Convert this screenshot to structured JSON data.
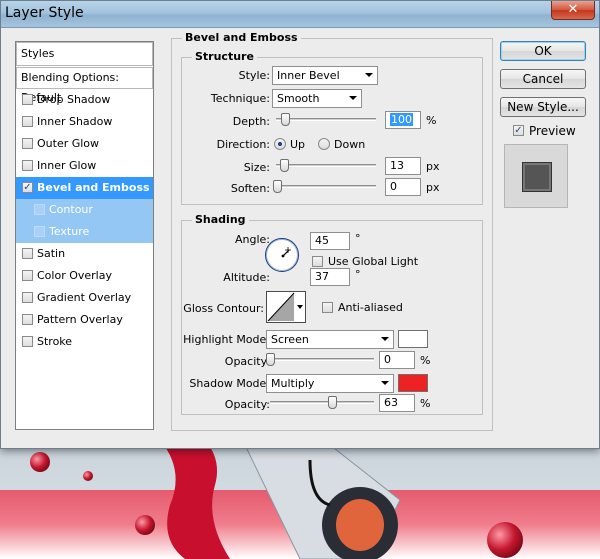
{
  "window": {
    "title": "Layer Style",
    "close_glyph": "✕"
  },
  "styles_list": {
    "header": "Styles",
    "blending": "Blending Options: Default",
    "items": [
      {
        "label": "Drop Shadow",
        "checked": false
      },
      {
        "label": "Inner Shadow",
        "checked": false
      },
      {
        "label": "Outer Glow",
        "checked": false
      },
      {
        "label": "Inner Glow",
        "checked": false
      },
      {
        "label": "Bevel and Emboss",
        "checked": true
      },
      {
        "label": "Contour",
        "checked": false
      },
      {
        "label": "Texture",
        "checked": false
      },
      {
        "label": "Satin",
        "checked": false
      },
      {
        "label": "Color Overlay",
        "checked": false
      },
      {
        "label": "Gradient Overlay",
        "checked": false
      },
      {
        "label": "Pattern Overlay",
        "checked": false
      },
      {
        "label": "Stroke",
        "checked": false
      }
    ]
  },
  "bevel": {
    "title": "Bevel and Emboss",
    "structure": {
      "title": "Structure",
      "style_label": "Style:",
      "style_value": "Inner Bevel",
      "technique_label": "Technique:",
      "technique_value": "Smooth",
      "depth_label": "Depth:",
      "depth_value": "100",
      "depth_unit": "%",
      "direction_label": "Direction:",
      "dir_up": "Up",
      "dir_down": "Down",
      "size_label": "Size:",
      "size_value": "13",
      "size_unit": "px",
      "soften_label": "Soften:",
      "soften_value": "0",
      "soften_unit": "px"
    },
    "shading": {
      "title": "Shading",
      "angle_label": "Angle:",
      "angle_value": "45",
      "angle_unit": "°",
      "global_light": "Use Global Light",
      "altitude_label": "Altitude:",
      "altitude_value": "37",
      "altitude_unit": "°",
      "gloss_label": "Gloss Contour:",
      "anti_aliased": "Anti-aliased",
      "highlight_label": "Highlight Mode:",
      "highlight_value": "Screen",
      "highlight_color": "#ffffff",
      "hl_opacity_label": "Opacity:",
      "hl_opacity_value": "0",
      "hl_opacity_unit": "%",
      "shadow_label": "Shadow Mode:",
      "shadow_value": "Multiply",
      "shadow_color": "#ee2222",
      "sh_opacity_label": "Opacity:",
      "sh_opacity_value": "63",
      "sh_opacity_unit": "%"
    }
  },
  "buttons": {
    "ok": "OK",
    "cancel": "Cancel",
    "new_style": "New Style...",
    "preview": "Preview"
  }
}
